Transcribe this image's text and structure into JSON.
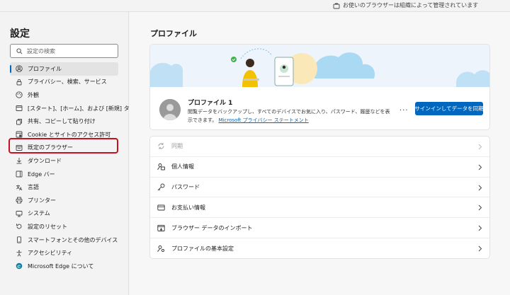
{
  "topbar": {
    "managed_notice": "お使いのブラウザーは組織によって管理されています"
  },
  "sidebar": {
    "title": "設定",
    "search_placeholder": "設定の検索",
    "items": [
      {
        "label": "プロファイル",
        "icon": "profile-icon"
      },
      {
        "label": "プライバシー、検索、サービス",
        "icon": "lock-icon"
      },
      {
        "label": "外観",
        "icon": "appearance-icon"
      },
      {
        "label": "[スタート]、[ホーム]、および [新規] タブ",
        "icon": "start-home-icon"
      },
      {
        "label": "共有、コピーして貼り付け",
        "icon": "share-icon"
      },
      {
        "label": "Cookie とサイトのアクセス許可",
        "icon": "cookie-icon"
      },
      {
        "label": "既定のブラウザー",
        "icon": "default-browser-icon"
      },
      {
        "label": "ダウンロード",
        "icon": "download-icon"
      },
      {
        "label": "Edge バー",
        "icon": "edge-bar-icon"
      },
      {
        "label": "言語",
        "icon": "language-icon"
      },
      {
        "label": "プリンター",
        "icon": "printer-icon"
      },
      {
        "label": "システム",
        "icon": "system-icon"
      },
      {
        "label": "設定のリセット",
        "icon": "reset-icon"
      },
      {
        "label": "スマートフォンとその他のデバイス",
        "icon": "phone-icon"
      },
      {
        "label": "アクセシビリティ",
        "icon": "accessibility-icon"
      },
      {
        "label": "Microsoft Edge について",
        "icon": "edge-logo-icon"
      }
    ]
  },
  "main": {
    "title": "プロファイル",
    "profile": {
      "name": "プロファイル 1",
      "description": "閲覧データをバックアップし、すべてのデバイスでお気に入り、パスワード、履歴などを表示できます。",
      "privacy_link": "Microsoft プライバシー ステートメント",
      "more": "...",
      "sync_button": "サインインしてデータを同期"
    },
    "rows": [
      {
        "label": "同期",
        "icon": "sync-icon",
        "disabled": true
      },
      {
        "label": "個人情報",
        "icon": "personal-info-icon"
      },
      {
        "label": "パスワード",
        "icon": "key-icon"
      },
      {
        "label": "お支払い情報",
        "icon": "card-icon"
      },
      {
        "label": "ブラウザー データのインポート",
        "icon": "import-icon"
      },
      {
        "label": "プロファイルの基本設定",
        "icon": "profile-settings-icon"
      }
    ]
  },
  "colors": {
    "accent": "#0067c0",
    "highlight": "#c8101f"
  }
}
